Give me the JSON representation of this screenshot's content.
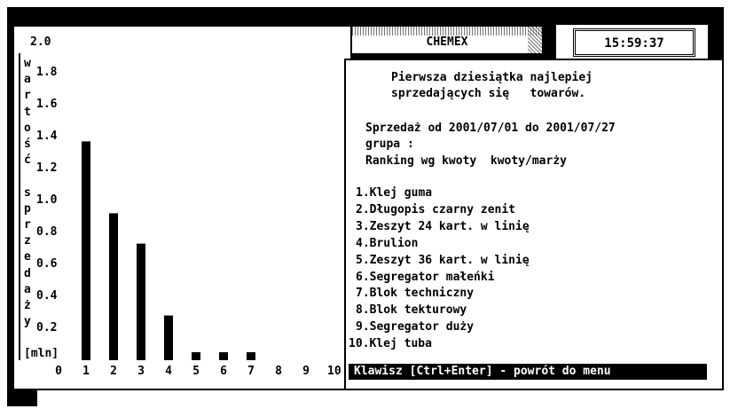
{
  "header": {
    "app_title": "CHEMEX",
    "clock": "15:59:37"
  },
  "info": {
    "heading_line1": "Pierwsza dziesiątka najlepiej",
    "heading_line2": "sprzedających się   towarów.",
    "date_range": "Sprzedaż od 2001/07/01 do 2001/07/27",
    "group": "grupa :",
    "ranking_mode": "Ranking wg kwoty  kwoty/marży"
  },
  "ranking": [
    "1.Klej guma",
    "2.Długopis czarny zenit",
    "3.Zeszyt 24 kart. w linię",
    "4.Brulion",
    "5.Zeszyt 36 kart. w linię",
    "6.Segregator małeńki",
    "7.Blok techniczny",
    "8.Blok tekturowy",
    "9.Segregator duży",
    "10.Klej tuba"
  ],
  "footer": {
    "hint": "Klawisz [Ctrl+Enter] - powrót do menu"
  },
  "chart_data": {
    "type": "bar",
    "ylabel_letters": [
      "w",
      "a",
      "r",
      "t",
      "o",
      "ś",
      "ć",
      "",
      "s",
      "p",
      "r",
      "z",
      "e",
      "d",
      "a",
      "ż",
      "y"
    ],
    "ylabel_unit": "[mln]",
    "ytick_labels": [
      "2.0",
      "1.8",
      "1.6",
      "1.4",
      "1.2",
      "1.0",
      "0.8",
      "0.6",
      "0.4",
      "0.2"
    ],
    "ylim": [
      0,
      2.0
    ],
    "categories": [
      "1",
      "2",
      "3",
      "4",
      "5",
      "6",
      "7",
      "8",
      "9",
      "10"
    ],
    "x_zero_label": "0",
    "values": [
      1.37,
      0.92,
      0.73,
      0.28,
      0.05,
      0.05,
      0.05,
      0,
      0,
      0
    ],
    "grid": false,
    "bar_color": "#000000"
  }
}
